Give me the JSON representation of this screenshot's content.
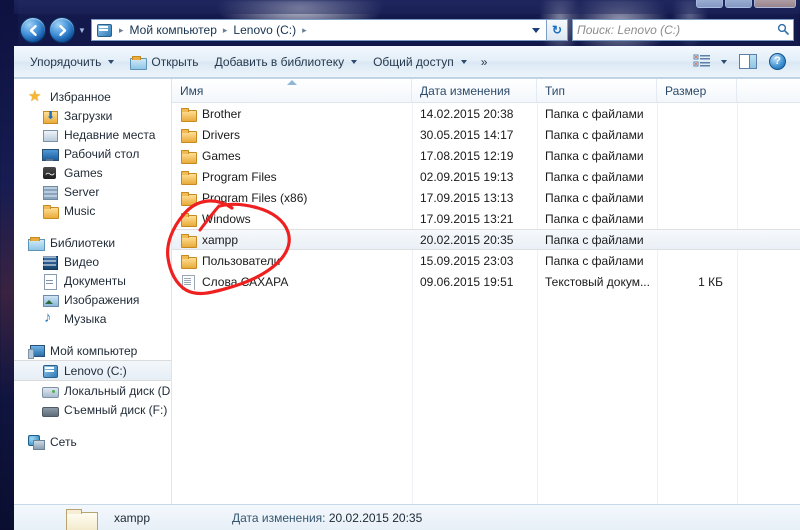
{
  "window": {
    "buttons": [
      "minimize",
      "maximize",
      "close"
    ]
  },
  "nav": {
    "back_label": "Назад",
    "forward_label": "Вперёд",
    "history_label": "Последние страницы",
    "breadcrumb_icon": "computer-icon",
    "crumbs": [
      "Мой компьютер",
      "Lenovo (C:)"
    ],
    "separator": "▸",
    "dropdown_label": "Предыдущие папки",
    "refresh_label": "Обновить",
    "refresh_glyph": "↻"
  },
  "search": {
    "placeholder": "Поиск: Lenovo (C:)",
    "value": "",
    "icon": "magnifier-icon",
    "icon_glyph": "🔍"
  },
  "toolbar": {
    "organize": "Упорядочить",
    "open": "Открыть",
    "add_to_library": "Добавить в библиотеку",
    "share": "Общий доступ",
    "overflow": "»",
    "view_label": "Изменить представление",
    "preview_label": "Область предварительного просмотра",
    "help_label": "Справка",
    "help_glyph": "?"
  },
  "sidebar": {
    "groups": [
      {
        "header": {
          "label": "Избранное",
          "icon": "star-icon"
        },
        "items": [
          {
            "label": "Загрузки",
            "icon": "downloads-icon"
          },
          {
            "label": "Недавние места",
            "icon": "recent-places-icon"
          },
          {
            "label": "Рабочий стол",
            "icon": "desktop-icon"
          },
          {
            "label": "Games",
            "icon": "games-folder-icon"
          },
          {
            "label": "Server",
            "icon": "server-icon"
          },
          {
            "label": "Music",
            "icon": "music-folder-icon"
          }
        ]
      },
      {
        "header": {
          "label": "Библиотеки",
          "icon": "libraries-icon"
        },
        "items": [
          {
            "label": "Видео",
            "icon": "video-library-icon"
          },
          {
            "label": "Документы",
            "icon": "documents-library-icon"
          },
          {
            "label": "Изображения",
            "icon": "pictures-library-icon"
          },
          {
            "label": "Музыка",
            "icon": "music-library-icon"
          }
        ]
      },
      {
        "header": {
          "label": "Мой компьютер",
          "icon": "computer-icon"
        },
        "items": [
          {
            "label": "Lenovo (C:)",
            "icon": "windows-drive-icon",
            "selected": true
          },
          {
            "label": "Локальный диск  (D:)",
            "icon": "hard-disk-icon"
          },
          {
            "label": "Съемный диск (F:)",
            "icon": "removable-disk-icon"
          }
        ]
      },
      {
        "header": {
          "label": "Сеть",
          "icon": "network-icon"
        },
        "items": []
      }
    ]
  },
  "filelist": {
    "columns": [
      {
        "key": "name",
        "label": "Имя",
        "sorted": true
      },
      {
        "key": "date",
        "label": "Дата изменения",
        "sorted": false
      },
      {
        "key": "type",
        "label": "Тип",
        "sorted": false
      },
      {
        "key": "size",
        "label": "Размер",
        "sorted": false
      }
    ],
    "rows": [
      {
        "name": "Brother",
        "date": "14.02.2015 20:38",
        "type": "Папка с файлами",
        "size": "",
        "icon": "folder-icon",
        "selected": false
      },
      {
        "name": "Drivers",
        "date": "30.05.2015 14:17",
        "type": "Папка с файлами",
        "size": "",
        "icon": "folder-icon",
        "selected": false
      },
      {
        "name": "Games",
        "date": "17.08.2015 12:19",
        "type": "Папка с файлами",
        "size": "",
        "icon": "folder-icon",
        "selected": false
      },
      {
        "name": "Program Files",
        "date": "02.09.2015 19:13",
        "type": "Папка с файлами",
        "size": "",
        "icon": "folder-icon",
        "selected": false
      },
      {
        "name": "Program Files (x86)",
        "date": "17.09.2015 13:13",
        "type": "Папка с файлами",
        "size": "",
        "icon": "folder-icon",
        "selected": false
      },
      {
        "name": "Windows",
        "date": "17.09.2015 13:21",
        "type": "Папка с файлами",
        "size": "",
        "icon": "folder-icon",
        "selected": false
      },
      {
        "name": "xampp",
        "date": "20.02.2015 20:35",
        "type": "Папка с файлами",
        "size": "",
        "icon": "folder-icon",
        "selected": true
      },
      {
        "name": "Пользователи",
        "date": "15.09.2015 23:03",
        "type": "Папка с файлами",
        "size": "",
        "icon": "folder-icon",
        "selected": false
      },
      {
        "name": "Слова САХАРА",
        "date": "09.06.2015 19:51",
        "type": "Текстовый докум...",
        "size": "1 КБ",
        "icon": "text-file-icon",
        "selected": false
      }
    ]
  },
  "statusbar": {
    "item_name": "xampp",
    "date_label": "Дата изменения:",
    "date_value": "20.02.2015 20:35",
    "icon": "folder-large-icon"
  },
  "annotation": {
    "type": "hand-drawn-ellipse",
    "color": "#ef2020",
    "targets": [
      "Windows",
      "xampp",
      "Пользователи"
    ]
  }
}
